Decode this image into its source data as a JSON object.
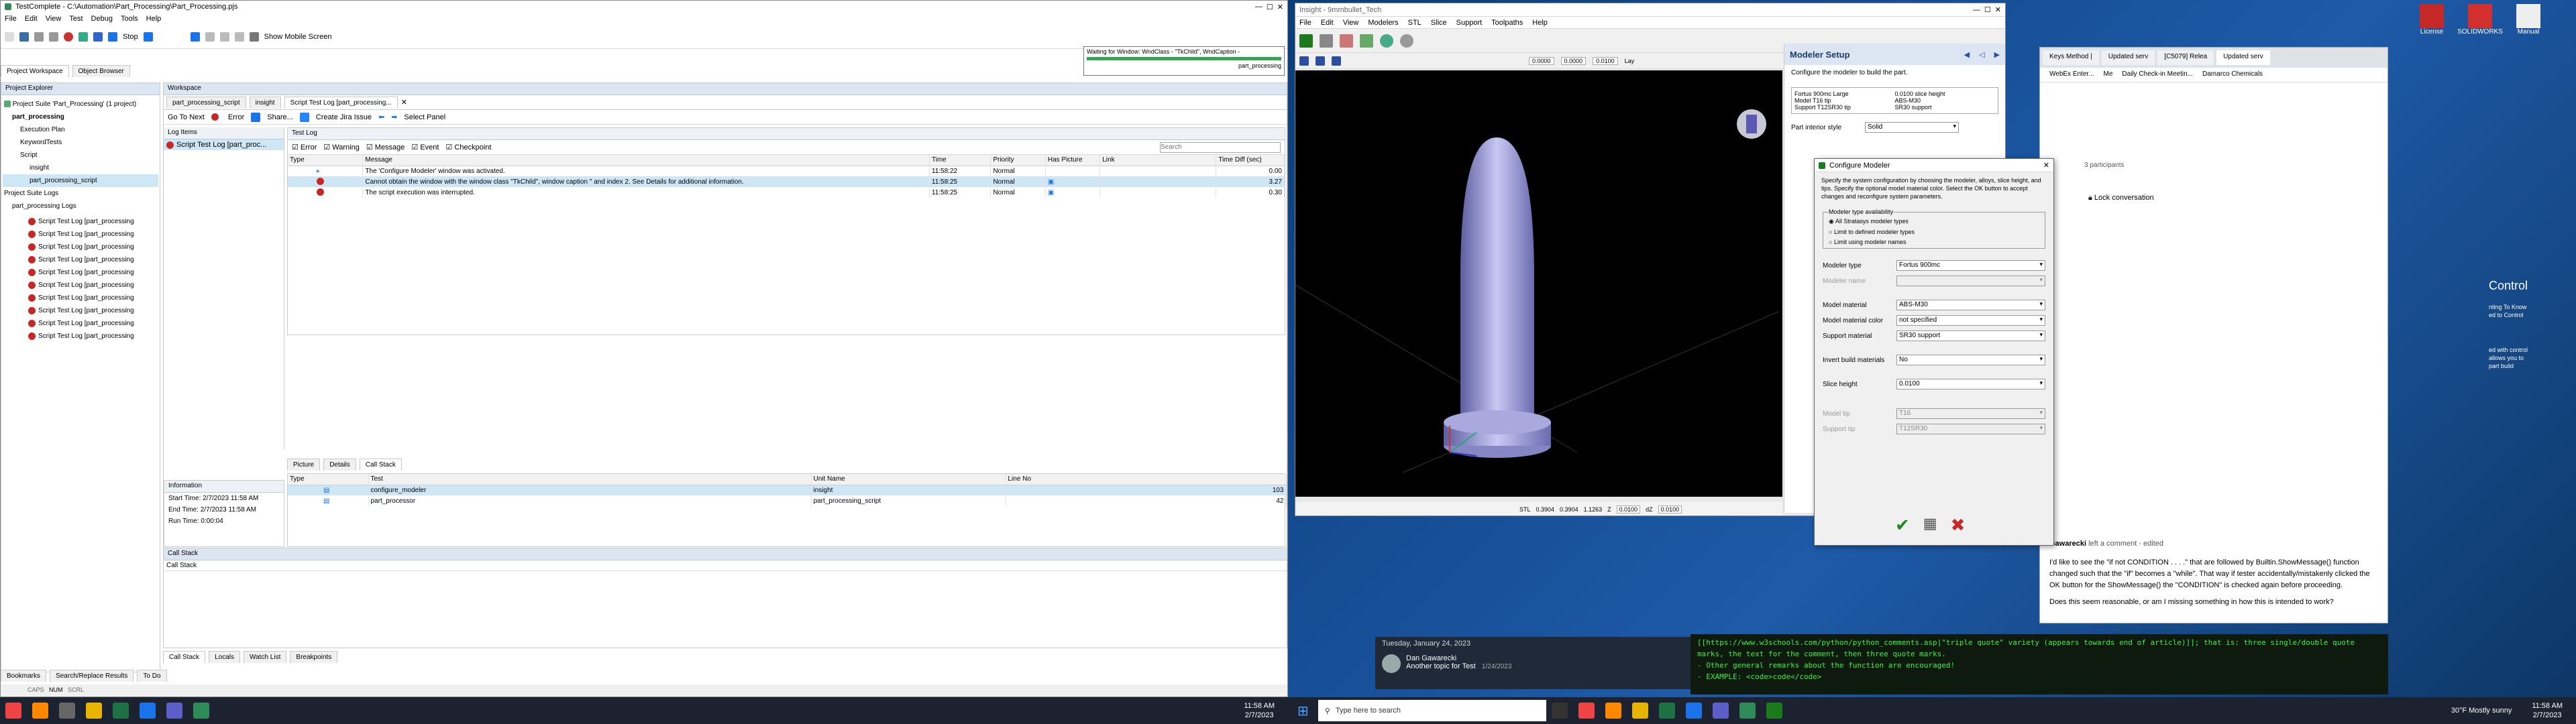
{
  "tc": {
    "title": "TestComplete - C:\\Automation\\Part_Processing\\Part_Processing.pjs",
    "menu": [
      "File",
      "Edit",
      "View",
      "Test",
      "Debug",
      "Tools",
      "Help"
    ],
    "toolbar": {
      "stop": "Stop",
      "mobile": "Show Mobile Screen"
    },
    "waiting_line1": "Waiting for Window: WndClass - \"TkChild\", WndCaption -",
    "waiting_line2": "part_processing",
    "tabs_left": [
      "Project Workspace",
      "Object Browser"
    ],
    "explorer_title": "Project Explorer",
    "tree": [
      "Project Suite 'Part_Processing' (1 project)",
      "part_processing",
      "Execution Plan",
      "KeywordTests",
      "Script",
      "insight",
      "part_processing_script",
      "Project Suite Logs",
      "part_processing Logs"
    ],
    "log_rows": [
      "Script Test Log [part_processing",
      "Script Test Log [part_processing",
      "Script Test Log [part_processing",
      "Script Test Log [part_processing",
      "Script Test Log [part_processing",
      "Script Test Log [part_processing",
      "Script Test Log [part_processing",
      "Script Test Log [part_processing",
      "Script Test Log [part_processing",
      "Script Test Log [part_processing"
    ],
    "workspace_title": "Workspace",
    "doc_tabs": [
      "part_processing_script",
      "insight",
      "Script Test Log [part_processing..."
    ],
    "actions": {
      "go_next": "Go To Next",
      "error": "Error",
      "share": "Share...",
      "create_issue": "Create Jira Issue",
      "select_panel": "Select Panel"
    },
    "log_items_title": "Log Items",
    "log_items_entry": "Script Test Log [part_proc...",
    "test_log_title": "Test Log",
    "filters": [
      "Error",
      "Warning",
      "Message",
      "Event",
      "Checkpoint"
    ],
    "search_placeholder": "Search",
    "cols": [
      "Type",
      "Message",
      "Time",
      "Priority",
      "Has Picture",
      "Link",
      "Time Diff (sec)"
    ],
    "rows": [
      {
        "msg": "The 'Configure Modeler' window was activated.",
        "time": "11:58:22",
        "prio": "Normal",
        "diff": "0.00"
      },
      {
        "msg": "Cannot obtain the window with the window class \"TkChild\", window caption \" and index 2. See Details for additional information.",
        "time": "11:58:25",
        "prio": "Normal",
        "diff": "3.27"
      },
      {
        "msg": "The script execution was interrupted.",
        "time": "11:58:25",
        "prio": "Normal",
        "diff": "0.30"
      }
    ],
    "bottom_tabs": [
      "Picture",
      "Details",
      "Call Stack"
    ],
    "info_title": "Information",
    "info": [
      "Start Time: 2/7/2023 11:58 AM",
      "End Time: 2/7/2023 11:58 AM",
      "Run Time: 0:00:04"
    ],
    "cs_cols": [
      "Type",
      "Test",
      "Unit Name",
      "Line No"
    ],
    "cs_rows": [
      {
        "test": "configure_modeler",
        "unit": "insight",
        "line": "103"
      },
      {
        "test": "part_processor",
        "unit": "part_processing_script",
        "line": "42"
      }
    ],
    "callstack_title": "Call Stack",
    "callstack_col": "Call Stack",
    "lower_tabs": [
      "Call Stack",
      "Locals",
      "Watch List",
      "Breakpoints"
    ],
    "very_bottom_tabs": [
      "Bookmarks",
      "Search/Replace Results",
      "To Do"
    ],
    "status": [
      "CAPS",
      "NUM",
      "SCRL"
    ]
  },
  "insight": {
    "title": "Insight - 9mmbullet_Tech",
    "menu": [
      "File",
      "Edit",
      "View",
      "Modelers",
      "STL",
      "Slice",
      "Support",
      "Toolpaths",
      "Help"
    ],
    "tb_values": [
      "0.0000",
      "0.0000",
      "0.0100"
    ],
    "tb_label": "Lay",
    "status": [
      "STL",
      "0.3904",
      "0.3904",
      "1.1263",
      "Z",
      "0.0100",
      "dZ",
      "0.0100"
    ]
  },
  "modeler": {
    "title": "Modeler Setup",
    "desc": "Configure the modeler to build the part.",
    "summary": [
      "Fortus 900mc Large",
      "Model   T16 tip",
      "Support   T12SR30 tip",
      "0.0100 slice height",
      "ABS-M30",
      "SR30 support"
    ],
    "interior_label": "Part interior style",
    "interior_value": "Solid"
  },
  "dialog": {
    "title": "Configure Modeler",
    "desc": "Specify the system configuration by choosing the modeler, alloys, slice height, and tips. Specify the optional model material color. Select the OK button to accept changes and reconfigure system parameters.",
    "group": "Modeler type availability",
    "radios": [
      "All Stratasys modeler types",
      "Limit to defined modeler types",
      "Limit using modeler names"
    ],
    "fields": [
      {
        "label": "Modeler type",
        "value": "Fortus 900mc",
        "dis": false
      },
      {
        "label": "Modeler name",
        "value": "",
        "dis": true
      },
      {
        "label": "Model material",
        "value": "ABS-M30",
        "dis": false
      },
      {
        "label": "Model material color",
        "value": "not specified",
        "dis": false
      },
      {
        "label": "Support material",
        "value": "SR30 support",
        "dis": false
      },
      {
        "label": "Invert build materials",
        "value": "No",
        "dis": false
      },
      {
        "label": "Slice height",
        "value": "0.0100",
        "dis": false
      },
      {
        "label": "Model tip",
        "value": "T16",
        "dis": true
      },
      {
        "label": "Support tip",
        "value": "T12SR30",
        "dis": true
      }
    ]
  },
  "browser": {
    "tabs": [
      "Keys Method |",
      "Updated serv",
      "[C5079] Relea",
      "Updated serv"
    ],
    "bookmarks": [
      "WebEx Enter...",
      "Me",
      "Daily Check-in Meetin...",
      "Damarco Chemicals"
    ],
    "participants": "3 participants",
    "lock": "Lock conversation",
    "control": "Control",
    "side_text": [
      "nting To Know",
      "ed to Control",
      "ed with control",
      "allows you to",
      "part build"
    ]
  },
  "comment": {
    "author": "Gawarecki",
    "action": "left a comment",
    "edited": "edited",
    "body": "I'd like to see the \"if not CONDITION . . . .\" that are followed by Builtin.ShowMessage() function changed such that the \"if\" becomes a \"while\". That way if tester accidentally/mistakenly clicked the OK button for the ShowMessage() the \"CONDITION\" is checked again before proceeding.",
    "body2": "Does this seem reasonable, or am I missing something in how this is intended to work?",
    "date": "Tuesday, January 24, 2023",
    "chat_name": "Dan Gawarecki",
    "chat_topic": "Another topic for Test",
    "chat_date": "1/24/2023"
  },
  "green": {
    "l1": "[[https://www.w3schools.com/python/python_comments.asp|\"triple quote\" variety (appears towards end of article)]]; that is:  three single/double quote marks, the text for the comment, then three quote marks.",
    "l2": "- Other general remarks about the function are encouraged!",
    "l3": "- EXAMPLE: <code>code</code>"
  },
  "desktop_icons": [
    "License",
    "SOLIDWORKS",
    "Manual"
  ],
  "taskbar": {
    "time_left": "11:58 AM",
    "date_left": "2/7/2023",
    "search": "Type here to search",
    "weather": "30°F  Mostly sunny",
    "time_right": "11:58 AM",
    "date_right": "2/7/2023"
  }
}
